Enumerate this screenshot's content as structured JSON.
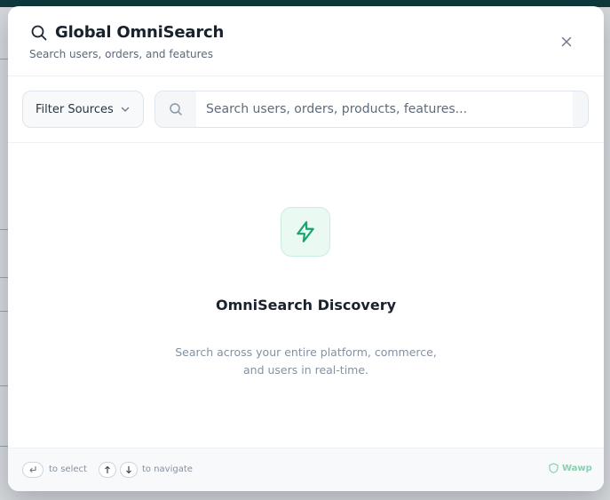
{
  "modal": {
    "title": "Global OmniSearch",
    "subtitle": "Search users, orders, and features",
    "icons": {
      "title": "search-icon",
      "close": "close-icon"
    }
  },
  "toolbar": {
    "filter_label": "Filter Sources",
    "search_placeholder": "Search users, orders, products, features..."
  },
  "empty_state": {
    "title": "OmniSearch Discovery",
    "description": "Search across your entire platform, commerce, and users in real-time.",
    "icon": "zap-icon"
  },
  "footer": {
    "select_hint": "to select",
    "navigate_hint": "to navigate",
    "brand": "Wawp"
  },
  "colors": {
    "accent": "#16a56c",
    "accent_bg": "#eafaf2",
    "brand": "#7fd5ad",
    "title": "#18212c",
    "muted": "#8391a1"
  }
}
